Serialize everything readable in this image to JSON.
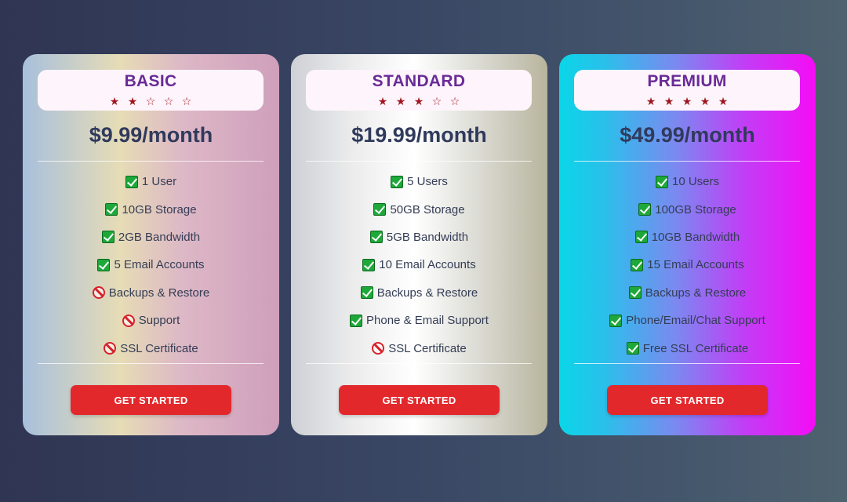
{
  "plans": [
    {
      "name": "BASIC",
      "rating": 2,
      "stars": [
        "★",
        "★",
        "☆",
        "☆",
        "☆"
      ],
      "price": "$9.99/month",
      "features": [
        {
          "text": "1 User",
          "icon": "check-icon"
        },
        {
          "text": "10GB Storage",
          "icon": "check-icon"
        },
        {
          "text": "2GB Bandwidth",
          "icon": "check-icon"
        },
        {
          "text": "5 Email Accounts",
          "icon": "check-icon"
        },
        {
          "text": "Backups & Restore",
          "icon": "prohibited-icon"
        },
        {
          "text": "Support",
          "icon": "prohibited-icon"
        },
        {
          "text": "SSL Certificate",
          "icon": "prohibited-icon"
        }
      ],
      "cta_label": "GET STARTED"
    },
    {
      "name": "STANDARD",
      "rating": 3,
      "stars": [
        "★",
        "★",
        "★",
        "☆",
        "☆"
      ],
      "price": "$19.99/month",
      "features": [
        {
          "text": "5 Users",
          "icon": "check-icon"
        },
        {
          "text": "50GB Storage",
          "icon": "check-icon"
        },
        {
          "text": "5GB Bandwidth",
          "icon": "check-icon"
        },
        {
          "text": "10 Email Accounts",
          "icon": "check-icon"
        },
        {
          "text": "Backups & Restore",
          "icon": "check-icon"
        },
        {
          "text": "Phone & Email Support",
          "icon": "check-icon"
        },
        {
          "text": "SSL Certificate",
          "icon": "prohibited-icon"
        }
      ],
      "cta_label": "GET STARTED"
    },
    {
      "name": "PREMIUM",
      "rating": 5,
      "stars": [
        "★",
        "★",
        "★",
        "★",
        "★"
      ],
      "price": "$49.99/month",
      "features": [
        {
          "text": "10 Users",
          "icon": "check-icon"
        },
        {
          "text": "100GB Storage",
          "icon": "check-icon"
        },
        {
          "text": "10GB Bandwidth",
          "icon": "check-icon"
        },
        {
          "text": "15 Email Accounts",
          "icon": "check-icon"
        },
        {
          "text": "Backups & Restore",
          "icon": "check-icon"
        },
        {
          "text": "Phone/Email/Chat Support",
          "icon": "check-icon"
        },
        {
          "text": "Free SSL Certificate",
          "icon": "check-icon"
        }
      ],
      "cta_label": "GET STARTED"
    }
  ],
  "colors": {
    "plan_name": "#6a2a97",
    "price": "#303a5c",
    "star": "#a01620",
    "cta_background": "#e3282c",
    "check": "#1ea83a",
    "prohibited": "#d8212a"
  }
}
